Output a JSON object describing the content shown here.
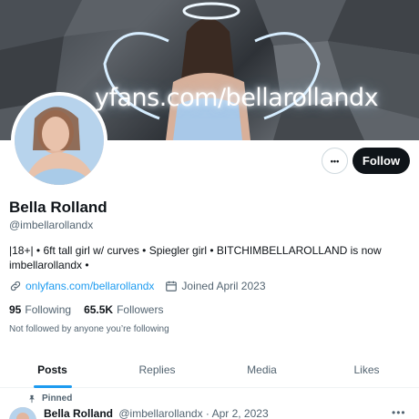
{
  "banner": {
    "watermark": "yfans.com/bellarollandx"
  },
  "profile": {
    "name": "Bella Rolland",
    "handle": "@imbellarollandx",
    "bio": "|18+| • 6ft tall girl w/ curves • Spiegler girl • BITCHIMBELLAROLLAND is now imbellarollandx •",
    "link": "onlyfans.com/bellarollandx",
    "joined": "Joined April 2023",
    "following_count": "95",
    "following_label": "Following",
    "followers_count": "65.5K",
    "followers_label": "Followers",
    "not_followed": "Not followed by anyone you’re following"
  },
  "actions": {
    "more": "•••",
    "follow": "Follow"
  },
  "tabs": [
    {
      "label": "Posts"
    },
    {
      "label": "Replies"
    },
    {
      "label": "Media"
    },
    {
      "label": "Likes"
    }
  ],
  "pinned_post": {
    "pinned_label": "Pinned",
    "author": "Bella Rolland",
    "handle_date": "@imbellarollandx · Apr 2, 2023",
    "more": "•••"
  },
  "colors": {
    "accent": "#1d9bf0",
    "follow_bg": "#0f1419",
    "muted": "#536471"
  },
  "icons": [
    "link-icon",
    "calendar-icon",
    "pin-icon",
    "more-icon"
  ]
}
